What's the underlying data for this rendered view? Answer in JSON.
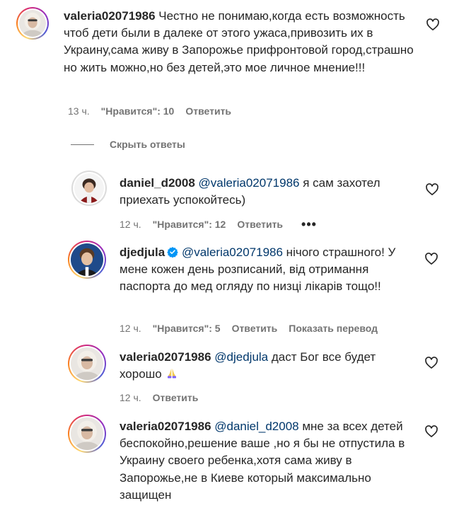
{
  "colors": {
    "text": "#262626",
    "secondary": "#737373",
    "mention": "#00376b",
    "verified": "#0095f6"
  },
  "hide_replies_label": "Скрыть ответы",
  "comments": [
    {
      "username": "valeria02071986",
      "text": "Честно не понимаю,когда есть возможность чтоб дети были в далеке от этого ужаса,привозить их в Украину,сама живу в Запорожье прифронтовой город,страшно но жить можно,но без детей,это мое личное мнение!!!",
      "time": "13 ч.",
      "likes": "\"Нравится\": 10",
      "reply": "Ответить"
    },
    {
      "username": "daniel_d2008",
      "mention": "@valeria02071986",
      "text": " я сам захотел приехать успокойтесь)",
      "time": "12 ч.",
      "likes": "\"Нравится\": 12",
      "reply": "Ответить",
      "more": "•••"
    },
    {
      "username": "djedjula",
      "mention": "@valeria02071986",
      "text": " нічого страшного! У мене кожен день розписаний, від отримання паспорта до мед огляду по низці лікарів тощо!!",
      "time": "12 ч.",
      "likes": "\"Нравится\": 5",
      "reply": "Ответить",
      "translate": "Показать перевод"
    },
    {
      "username": "valeria02071986",
      "mention": "@djedjula",
      "text": " даст Бог все будет хорошо",
      "emoji": "praying-hands",
      "time": "12 ч.",
      "reply": "Ответить"
    },
    {
      "username": "valeria02071986",
      "mention": "@daniel_d2008",
      "text": " мне за всех детей беспокойно,решение ваше ,но я бы не отпустила в Украину своего ребенка,хотя сама живу в Запорожье,не в Киеве который максимально защищен"
    }
  ]
}
